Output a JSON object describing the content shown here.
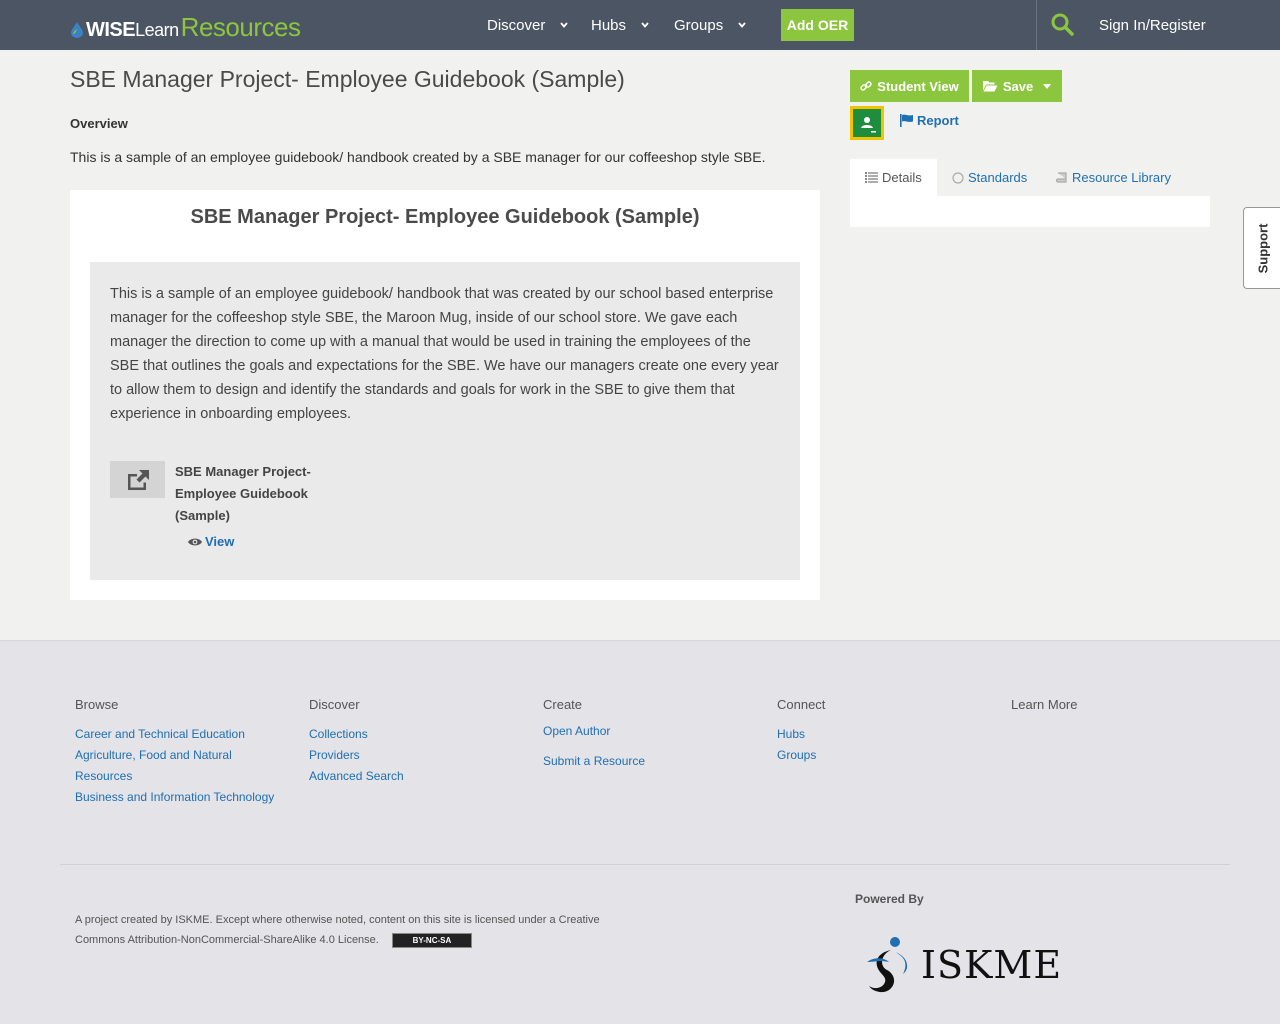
{
  "header": {
    "logo_wise": "WISE",
    "logo_learn": "Learn",
    "logo_resources": "Resources",
    "nav": [
      {
        "label": "Discover"
      },
      {
        "label": "Hubs"
      },
      {
        "label": "Groups"
      }
    ],
    "add_oer": "Add OER",
    "sign_in": "Sign In/Register"
  },
  "main": {
    "title": "SBE Manager Project- Employee Guidebook (Sample)",
    "overview_label": "Overview",
    "overview_text": "This is a sample of an employee guidebook/ handbook created by a SBE manager for our coffeeshop style SBE.",
    "card_title": "SBE Manager Project- Employee Guidebook (Sample)",
    "description": "This is a sample of an employee guidebook/ handbook that was created by our school based enterprise manager for the coffeeshop style SBE, the Maroon Mug, inside of our school store. We gave each manager the direction to come up with a manual that would be used in training the employees of the SBE that outlines the goals and expectations for the SBE. We have our managers create one every year to allow them to design and identify the standards and goals for work in the SBE to give them that experience in onboarding employees.",
    "attachment_name": "SBE Manager Project- Employee Guidebook (Sample)",
    "view_label": "View"
  },
  "sidebar": {
    "student_view": "Student View",
    "save": "Save",
    "report": "Report",
    "tabs": [
      {
        "label": "Details"
      },
      {
        "label": "Standards"
      },
      {
        "label": "Resource Library"
      }
    ]
  },
  "support_label": "Support",
  "footer": {
    "browse": {
      "heading": "Browse",
      "links": [
        "Career and Technical Education",
        "Agriculture, Food and Natural Resources",
        "Business and Information Technology"
      ]
    },
    "discover": {
      "heading": "Discover",
      "links": [
        "Collections",
        "Providers",
        "Advanced Search"
      ]
    },
    "create": {
      "heading": "Create",
      "links": [
        "Open Author",
        "Submit a Resource"
      ]
    },
    "connect": {
      "heading": "Connect",
      "links": [
        "Hubs",
        "Groups"
      ]
    },
    "learn_more": {
      "heading": "Learn More"
    },
    "license_text": "A project created by ISKME. Except where otherwise noted, content on this site is licensed under a Creative Commons Attribution-NonCommercial-ShareAlike 4.0 License.",
    "cc_badge": "BY-NC-SA",
    "powered_by": "Powered By",
    "iskme": "ISKME"
  },
  "colors": {
    "topbar": "#4b5563",
    "accent_green": "#8cc63f",
    "link_blue": "#1f6fb2"
  }
}
